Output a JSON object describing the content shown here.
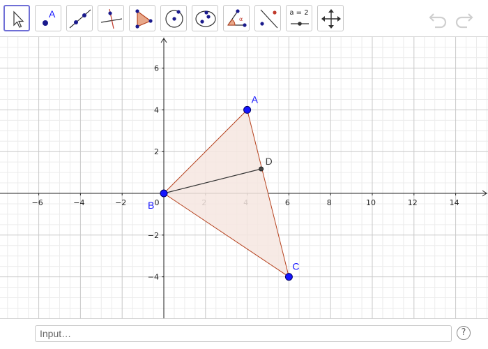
{
  "toolbar": {
    "tools": [
      {
        "name": "move-tool"
      },
      {
        "name": "point-tool",
        "label": "A"
      },
      {
        "name": "line-tool"
      },
      {
        "name": "perpendicular-line-tool"
      },
      {
        "name": "polygon-tool"
      },
      {
        "name": "circle-center-point-tool"
      },
      {
        "name": "conic-tool"
      },
      {
        "name": "angle-tool"
      },
      {
        "name": "reflect-tool"
      },
      {
        "name": "slider-tool",
        "label": "a = 2"
      },
      {
        "name": "move-graphics-view-tool"
      }
    ],
    "undo_icon": "undo-icon",
    "redo_icon": "redo-icon"
  },
  "graph": {
    "x_ticks": [
      -6,
      -4,
      -2,
      0,
      2,
      4,
      6,
      8,
      10,
      12,
      14
    ],
    "y_ticks": [
      -4,
      -2,
      2,
      4,
      6
    ],
    "x_tick_labels": [
      "−6",
      "−4",
      "−2",
      "0",
      "2",
      "4",
      "6",
      "8",
      "10",
      "12",
      "14"
    ],
    "y_tick_labels": [
      "−4",
      "−2",
      "2",
      "4",
      "6"
    ],
    "points": [
      {
        "label": "A",
        "x": 4,
        "y": 4,
        "color": "#1515ff"
      },
      {
        "label": "B",
        "x": 0,
        "y": 0,
        "color": "#1515ff"
      },
      {
        "label": "C",
        "x": 6,
        "y": -4,
        "color": "#1515ff"
      },
      {
        "label": "D",
        "x": 4.67,
        "y": 1.17,
        "color": "#444444"
      }
    ],
    "polygon_fill": "#f6e6e0",
    "polygon_stroke": "#b5401c",
    "segment_color": "#333333"
  },
  "input": {
    "placeholder": "Input…",
    "help_label": "?"
  }
}
